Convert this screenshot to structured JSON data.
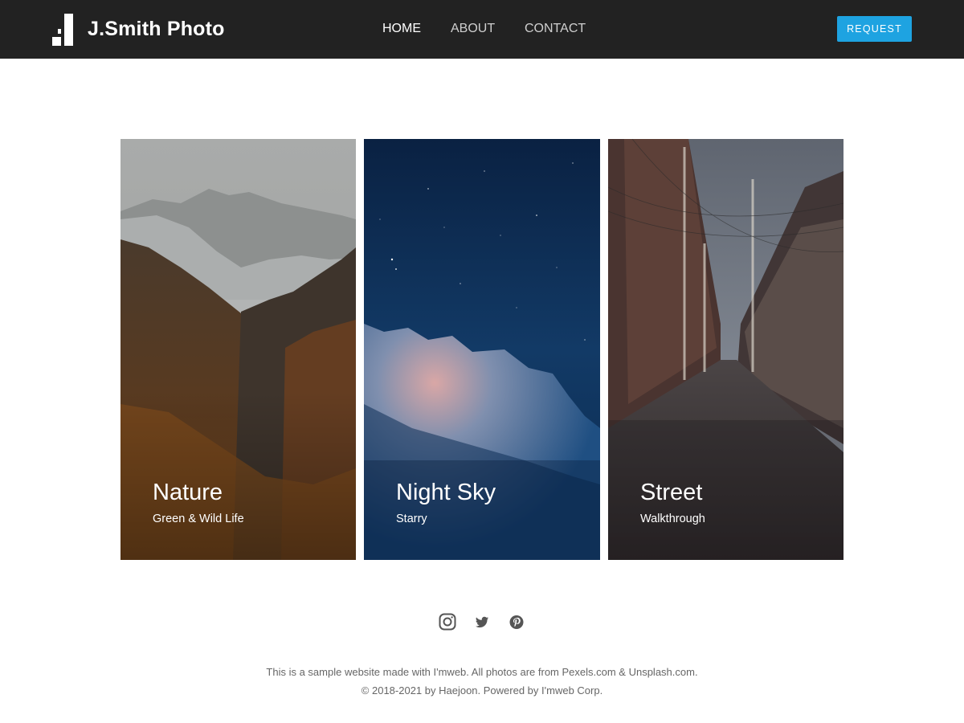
{
  "header": {
    "brand": "J.Smith Photo",
    "logo_icon": "bar-logo-icon",
    "nav": [
      {
        "label": "HOME",
        "active": true
      },
      {
        "label": "ABOUT",
        "active": false
      },
      {
        "label": "CONTACT",
        "active": false
      }
    ],
    "request_label": "REQUEST",
    "colors": {
      "background": "#222222",
      "accent": "#1ea3e1"
    }
  },
  "gallery": [
    {
      "title": "Nature",
      "subtitle": "Green & Wild Life"
    },
    {
      "title": "Night Sky",
      "subtitle": "Starry"
    },
    {
      "title": "Street",
      "subtitle": "Walkthrough"
    }
  ],
  "social": [
    {
      "icon": "instagram-icon"
    },
    {
      "icon": "twitter-icon"
    },
    {
      "icon": "pinterest-icon"
    }
  ],
  "footer": {
    "line1": "This is a sample website made with I'mweb. All photos are from Pexels.com & Unsplash.com.",
    "line2": "© 2018-2021 by Haejoon. Powered by I'mweb Corp."
  }
}
